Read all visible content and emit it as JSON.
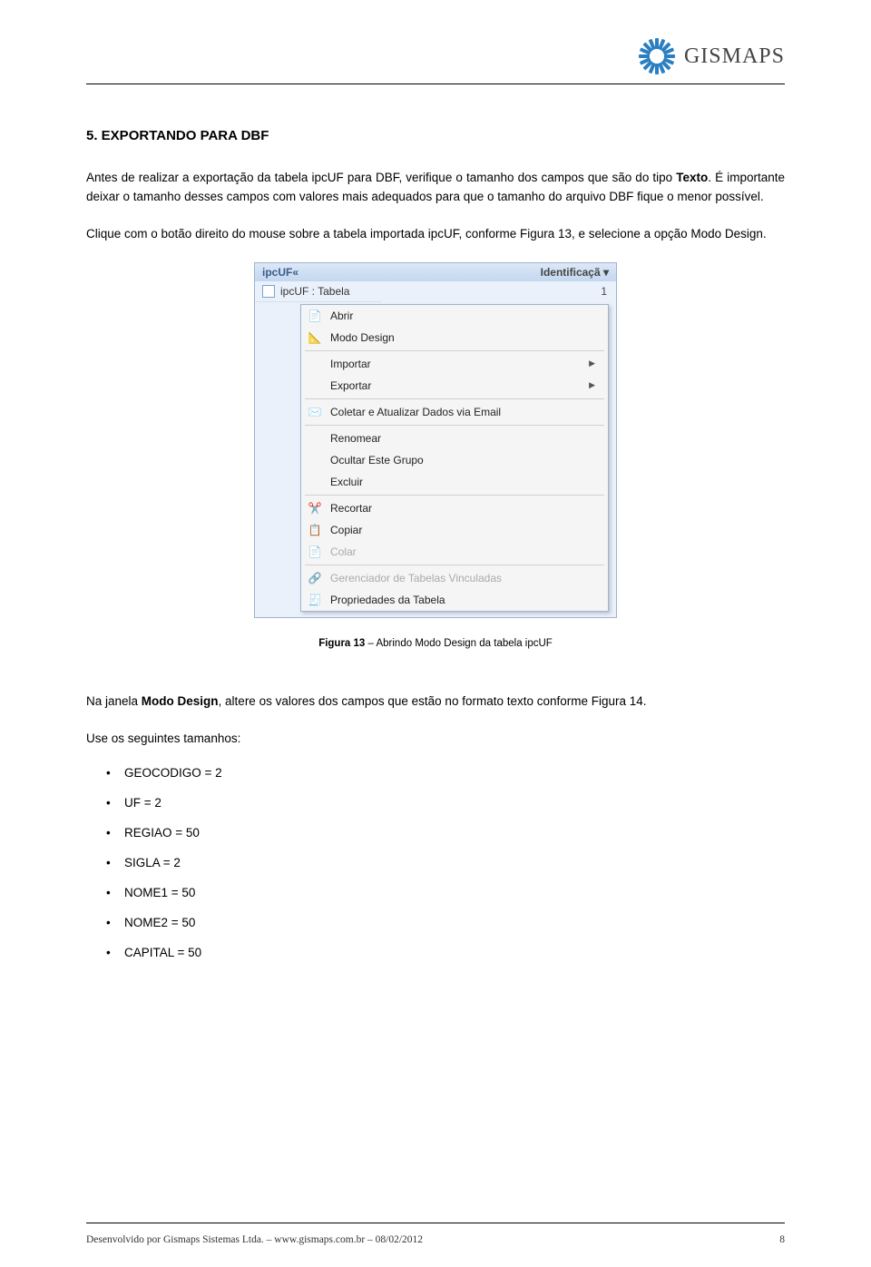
{
  "header": {
    "logo_text": "GISMAPS"
  },
  "section": {
    "heading": "5. EXPORTANDO PARA DBF",
    "para1_a": "Antes de realizar a exportação da tabela ipcUF para DBF, verifique o tamanho dos campos que são do tipo ",
    "para1_b": "Texto",
    "para1_c": ". É importante deixar o tamanho desses campos com valores mais adequados para que o tamanho do arquivo DBF fique o menor possível.",
    "para2": "Clique com o botão direito do mouse sobre a tabela importada ipcUF, conforme Figura 13, e selecione a opção Modo Design."
  },
  "screenshot": {
    "sidebar_title": "ipcUF",
    "sidebar_chevron": "«",
    "sidebar_label": "ipcUF : Tabela",
    "top_right": "Identificaçã",
    "top_right_num": "1",
    "menu": {
      "abrir": "Abrir",
      "modo_design": "Modo Design",
      "importar": "Importar",
      "exportar": "Exportar",
      "coletar": "Coletar e Atualizar Dados via Email",
      "renomear": "Renomear",
      "ocultar": "Ocultar Este Grupo",
      "excluir": "Excluir",
      "recortar": "Recortar",
      "copiar": "Copiar",
      "colar": "Colar",
      "gerenciador": "Gerenciador de Tabelas Vinculadas",
      "propriedades": "Propriedades da Tabela"
    }
  },
  "caption": {
    "prefix": "Figura 13",
    "rest": " – Abrindo Modo Design da tabela ipcUF"
  },
  "section2": {
    "para_a": "Na janela ",
    "para_b": "Modo Design",
    "para_c": ", altere os valores dos campos que estão no formato texto conforme Figura 14.",
    "intro": "Use os seguintes tamanhos:",
    "items": {
      "i0": "GEOCODIGO = 2",
      "i1": "UF = 2",
      "i2": "REGIAO = 50",
      "i3": "SIGLA = 2",
      "i4": "NOME1 = 50",
      "i5": "NOME2 = 50",
      "i6": "CAPITAL = 50"
    }
  },
  "footer": {
    "left": "Desenvolvido por Gismaps Sistemas Ltda. – www.gismaps.com.br – 08/02/2012",
    "right": "8"
  }
}
